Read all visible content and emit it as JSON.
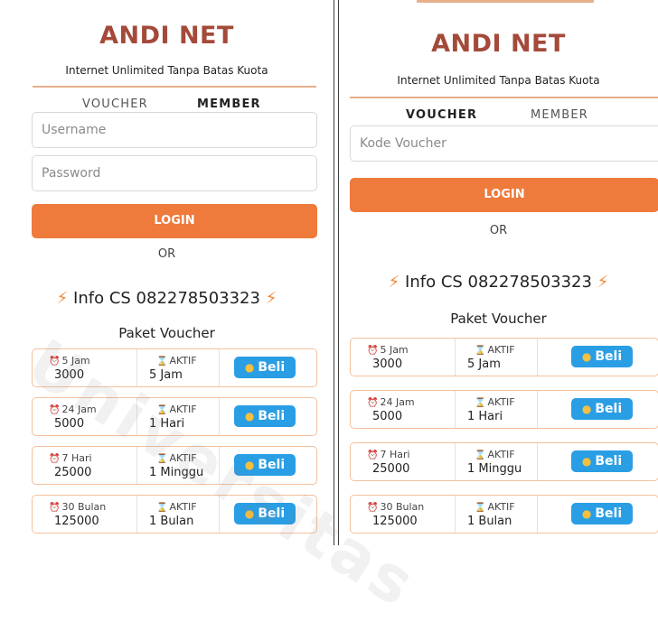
{
  "left": {
    "brand": "ANDI NET",
    "tagline": "Internet Unlimited Tanpa Batas Kuota",
    "tabs": [
      "VOUCHER",
      "MEMBER"
    ],
    "active_tab": "MEMBER",
    "username_placeholder": "Username",
    "password_placeholder": "Password",
    "login_label": "LOGIN",
    "or_label": "OR",
    "info_label": "Info CS 082278503323",
    "paket_title": "Paket Voucher",
    "packages": [
      {
        "duration": "5 Jam",
        "price": "3000",
        "status": "AKTIF",
        "active_period": "5 Jam",
        "buy_label": "Beli"
      },
      {
        "duration": "24 Jam",
        "price": "5000",
        "status": "AKTIF",
        "active_period": "1 Hari",
        "buy_label": "Beli"
      },
      {
        "duration": "7 Hari",
        "price": "25000",
        "status": "AKTIF",
        "active_period": "1 Minggu",
        "buy_label": "Beli"
      },
      {
        "duration": "30 Bulan",
        "price": "125000",
        "status": "AKTIF",
        "active_period": "1 Bulan",
        "buy_label": "Beli"
      }
    ]
  },
  "right": {
    "brand": "ANDI NET",
    "tagline": "Internet Unlimited Tanpa Batas Kuota",
    "tabs": [
      "VOUCHER",
      "MEMBER"
    ],
    "active_tab": "VOUCHER",
    "voucher_placeholder": "Kode Voucher",
    "login_label": "LOGIN",
    "or_label": "OR",
    "info_label": "Info CS 082278503323",
    "paket_title": "Paket Voucher",
    "packages": [
      {
        "duration": "5 Jam",
        "price": "3000",
        "status": "AKTIF",
        "active_period": "5 Jam",
        "buy_label": "Beli"
      },
      {
        "duration": "24 Jam",
        "price": "5000",
        "status": "AKTIF",
        "active_period": "1 Hari",
        "buy_label": "Beli"
      },
      {
        "duration": "7 Hari",
        "price": "25000",
        "status": "AKTIF",
        "active_period": "1 Minggu",
        "buy_label": "Beli"
      },
      {
        "duration": "30 Bulan",
        "price": "125000",
        "status": "AKTIF",
        "active_period": "1 Bulan",
        "buy_label": "Beli"
      }
    ]
  },
  "icons": {
    "bolt": "lightning-icon",
    "clock": "alarm-clock-icon",
    "hourglass": "hourglass-icon",
    "money_bag": "money-bag-icon"
  },
  "colors": {
    "brand": "#a44a3a",
    "accent": "#ee7a3c",
    "buy_button": "#2a9ee4",
    "row_border": "#f3c09c"
  },
  "watermark": "Universitas"
}
